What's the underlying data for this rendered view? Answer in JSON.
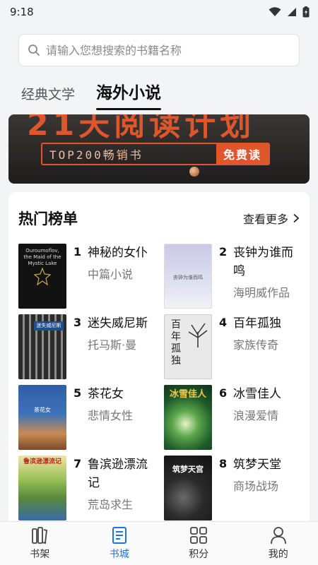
{
  "status": {
    "time": "9:18"
  },
  "search": {
    "placeholder": "请输入您想搜索的书籍名称"
  },
  "tabs": [
    {
      "label": "经典文学",
      "active": false
    },
    {
      "label": "海外小说",
      "active": true
    }
  ],
  "banner": {
    "headline": "21天阅读计划",
    "pill_text": "TOP200畅销书",
    "pill_badge": "免费读"
  },
  "section": {
    "title": "热门榜单",
    "more_label": "查看更多"
  },
  "books": [
    {
      "rank": "1",
      "title": "神秘的女仆",
      "subtitle": "中篇小说",
      "cover_text": "Ouroumoflov, the Maid of the Mystic Lake"
    },
    {
      "rank": "2",
      "title": "丧钟为谁而鸣",
      "subtitle": "海明威作品",
      "cover_text": "丧钟为谁而鸣"
    },
    {
      "rank": "3",
      "title": "迷失威尼斯",
      "subtitle": "托马斯·曼",
      "cover_text": "迷失威尼斯"
    },
    {
      "rank": "4",
      "title": "百年孤独",
      "subtitle": "家族传奇",
      "cover_text": "百年孤独"
    },
    {
      "rank": "5",
      "title": "茶花女",
      "subtitle": "悲情女性",
      "cover_text": "茶花女"
    },
    {
      "rank": "6",
      "title": "冰雪佳人",
      "subtitle": "浪漫爱情",
      "cover_text": "冰雪佳人"
    },
    {
      "rank": "7",
      "title": "鲁滨逊漂流记",
      "subtitle": "荒岛求生",
      "cover_text": "鲁滨逊漂流记"
    },
    {
      "rank": "8",
      "title": "筑梦天堂",
      "subtitle": "商场战场",
      "cover_text": "筑梦天宫"
    }
  ],
  "nav": [
    {
      "label": "书架",
      "icon": "bookshelf-icon",
      "active": false
    },
    {
      "label": "书城",
      "icon": "bookstore-icon",
      "active": true
    },
    {
      "label": "积分",
      "icon": "points-grid-icon",
      "active": false
    },
    {
      "label": "我的",
      "icon": "profile-icon",
      "active": false
    }
  ],
  "colors": {
    "accent": "#1e74d8",
    "banner_orange": "#e0562c"
  }
}
